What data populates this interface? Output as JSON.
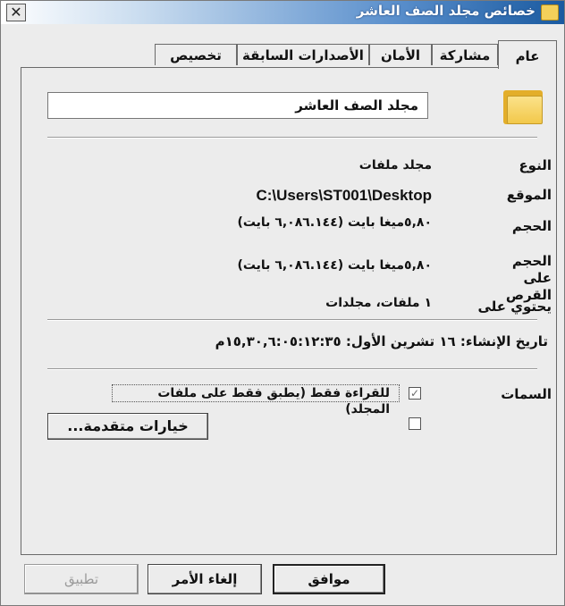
{
  "window": {
    "title": "خصائص مجلد الصف العاشر",
    "close_label": "✕"
  },
  "tabs": [
    {
      "label": "عام",
      "active": true
    },
    {
      "label": "مشاركة",
      "active": false
    },
    {
      "label": "الأمان",
      "active": false
    },
    {
      "label": "الأصدارات السابقة",
      "active": false
    },
    {
      "label": "تخصيص",
      "active": false
    }
  ],
  "folder": {
    "name": "مجلد الصف العاشر",
    "icon": "folder-icon"
  },
  "properties": {
    "type": {
      "label": "النوع",
      "value": "مجلد ملفات"
    },
    "location": {
      "label": "الموقع",
      "value": "C:\\Users\\ST001\\Desktop"
    },
    "size": {
      "label": "الحجم",
      "value": "٥,٨٠ميغا بايت (٦,٠٨٦.١٤٤ بايت)"
    },
    "size_on_disk": {
      "label": "الحجم على القرص",
      "value": "٥,٨٠ميغا بايت (٦,٠٨٦.١٤٤ بايت)"
    },
    "contains": {
      "label": "يحتوي على",
      "value": "١ ملفات، مجلدات"
    },
    "created": "تاريخ الإنشاء: ١٦ تشرين الأول: ١٥,٣٠,٦:٠٥:١٢:٣٥م"
  },
  "attributes": {
    "label": "السمات",
    "readonly": {
      "label": "للقراءة فقط (يطبق فقط على ملفات المجلد)",
      "checked": true,
      "disabled": true
    },
    "hidden": {
      "checked": false
    },
    "advanced_button": "خيارات متقدمة..."
  },
  "buttons": {
    "ok": "موافق",
    "cancel": "إلغاء الأمر",
    "apply": "تطبيق"
  }
}
